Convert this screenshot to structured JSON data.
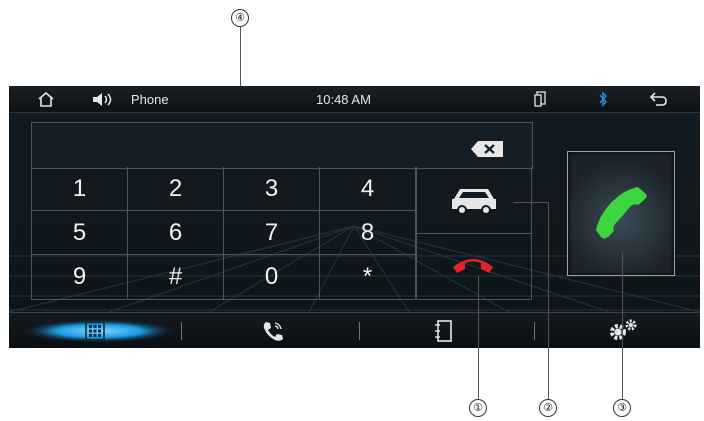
{
  "statusbar": {
    "app_label": "Phone",
    "time": "10:48 AM",
    "home_icon": "home-icon",
    "volume_icon": "volume-icon",
    "phone_link_icon": "phone-link-icon",
    "bluetooth_icon": "bluetooth-icon",
    "back_icon": "back-icon"
  },
  "dialpad": {
    "display_value": "",
    "keys": [
      "1",
      "2",
      "3",
      "4",
      "5",
      "6",
      "7",
      "8",
      "9",
      "#",
      "0",
      "*"
    ]
  },
  "bottom_nav": {
    "items": [
      "dialpad-icon",
      "call-log-icon",
      "contacts-icon",
      "settings-icon"
    ],
    "active_index": 0
  },
  "callouts": [
    "④",
    "①",
    "②",
    "③"
  ],
  "colors": {
    "accent": "#2bb7f0",
    "hangup": "#e0222a",
    "call": "#33d43f"
  }
}
